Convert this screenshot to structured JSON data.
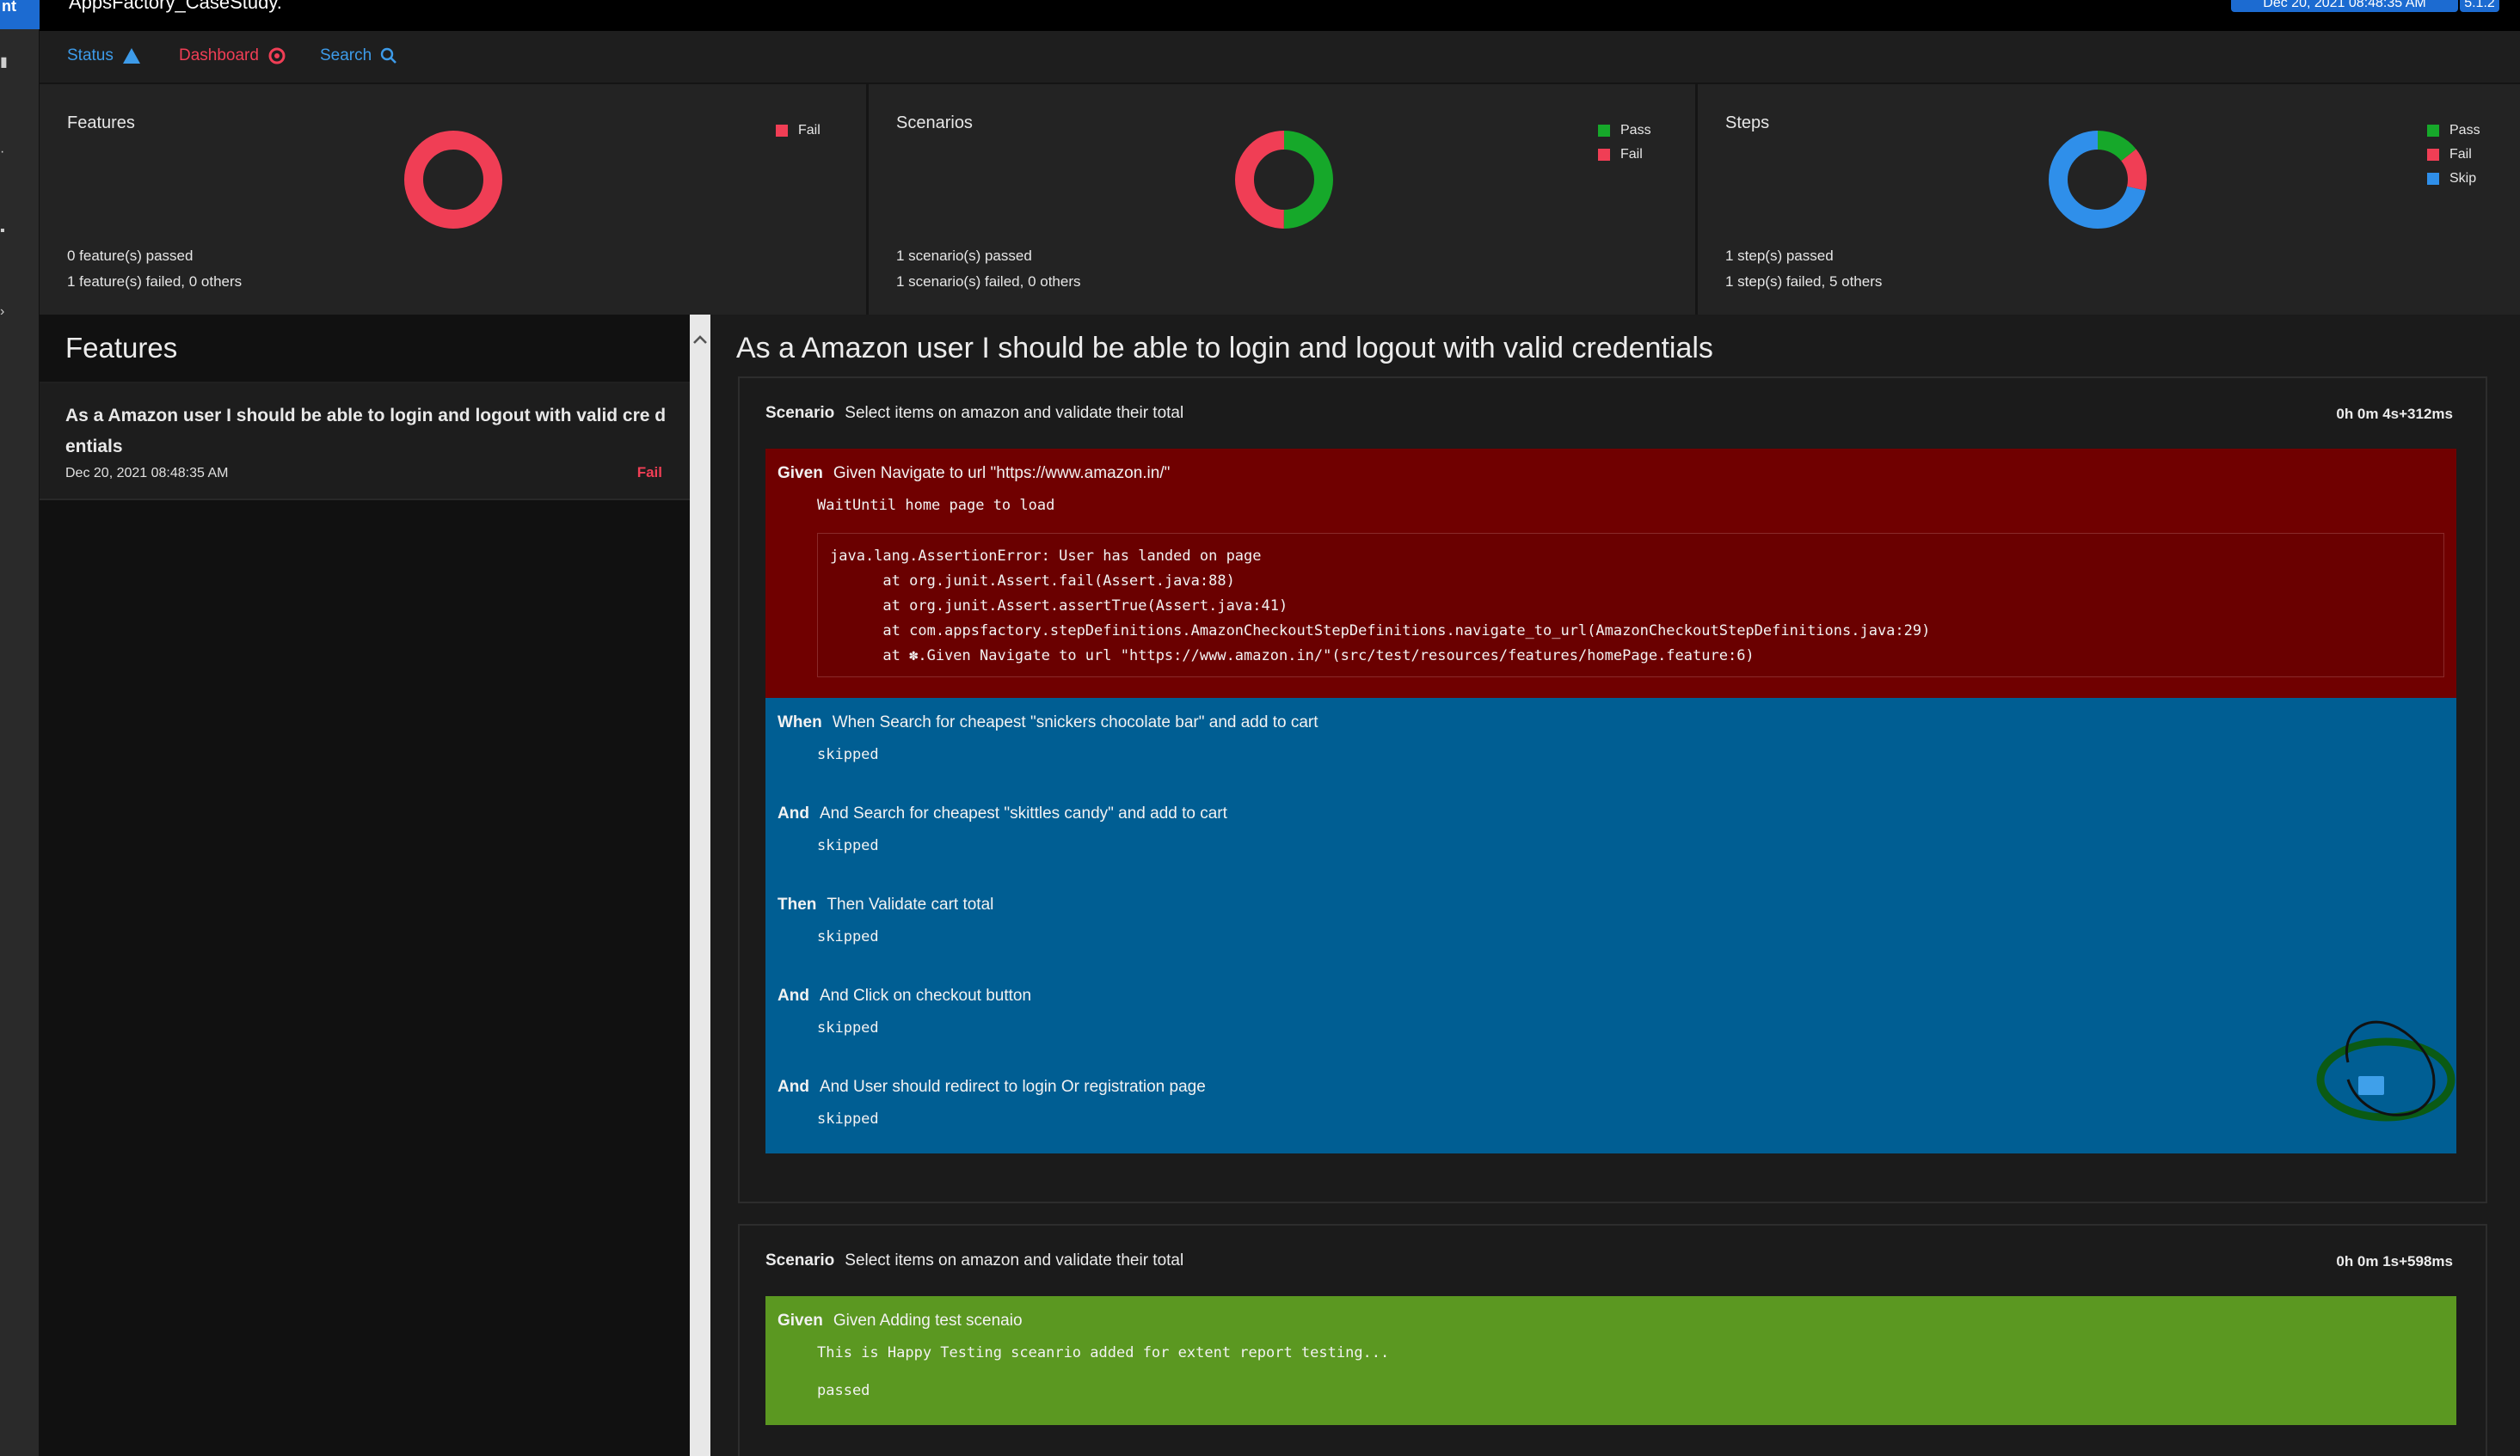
{
  "leftbar": {
    "brand": "nt",
    "icons": [
      "bars-icon",
      "dot-icon",
      "tag-icon",
      "dot2-icon"
    ]
  },
  "header": {
    "app_title": "AppsFactory_CaseStudy.",
    "date": "Dec 20, 2021 08:48:35 AM",
    "version": "5.1.2"
  },
  "nav": {
    "status": "Status",
    "dashboard": "Dashboard",
    "search": "Search"
  },
  "colors": {
    "pass": "#16a82a",
    "fail": "#f03e55",
    "skip": "#2f8fea"
  },
  "summary": {
    "features": {
      "title": "Features",
      "legend": [
        "Fail"
      ],
      "chart_values": {
        "pass": 0,
        "fail": 1,
        "skip": 0
      },
      "stat1": "0 feature(s) passed",
      "stat2": "1 feature(s) failed, 0 others"
    },
    "scenarios": {
      "title": "Scenarios",
      "legend": [
        "Pass",
        "Fail"
      ],
      "chart_values": {
        "pass": 1,
        "fail": 1,
        "skip": 0
      },
      "stat1": "1 scenario(s) passed",
      "stat2": "1 scenario(s) failed, 0 others"
    },
    "steps": {
      "title": "Steps",
      "legend": [
        "Pass",
        "Fail",
        "Skip"
      ],
      "chart_values": {
        "pass": 1,
        "fail": 1,
        "skip": 5
      },
      "stat1": "1 step(s) passed",
      "stat2": "1 step(s) failed, 5 others"
    }
  },
  "features_list": {
    "title": "Features",
    "items": [
      {
        "title": "As a Amazon user I should be able to login and logout with valid cre dentials",
        "date": "Dec 20, 2021 08:48:35 AM",
        "status": "Fail"
      }
    ]
  },
  "detail": {
    "title": "As a Amazon user I should be able to login and logout with valid credentials",
    "scenarios": [
      {
        "keyword": "Scenario",
        "name": "Select items on amazon and validate their total",
        "duration": "0h 0m 4s+312ms",
        "steps": [
          {
            "keyword": "Given",
            "text": "Given Navigate to url \"https://www.amazon.in/\"",
            "sub": "WaitUntil home page to load",
            "trace": "java.lang.AssertionError: User has landed on page\n      at org.junit.Assert.fail(Assert.java:88)\n      at org.junit.Assert.assertTrue(Assert.java:41)\n      at com.appsfactory.stepDefinitions.AmazonCheckoutStepDefinitions.navigate_to_url(AmazonCheckoutStepDefinitions.java:29)\n      at ✽.Given Navigate to url \"https://www.amazon.in/\"(src/test/resources/features/homePage.feature:6)"
          },
          {
            "keyword": "When",
            "text": "When Search for cheapest \"snickers chocolate bar\" and add to cart",
            "sub": "skipped"
          },
          {
            "keyword": "And",
            "text": "And Search for cheapest \"skittles candy\" and add to cart",
            "sub": "skipped"
          },
          {
            "keyword": "Then",
            "text": "Then Validate cart total",
            "sub": "skipped"
          },
          {
            "keyword": "And",
            "text": "And Click on checkout button",
            "sub": "skipped"
          },
          {
            "keyword": "And",
            "text": "And User should redirect to login Or registration page",
            "sub": "skipped"
          }
        ]
      },
      {
        "keyword": "Scenario",
        "name": "Select items on amazon and validate their total",
        "duration": "0h 0m 1s+598ms",
        "steps": [
          {
            "keyword": "Given",
            "text": "Given Adding test scenaio",
            "sub": "This is Happy Testing sceanrio added for extent report testing...",
            "sub2": "passed"
          }
        ]
      }
    ]
  }
}
